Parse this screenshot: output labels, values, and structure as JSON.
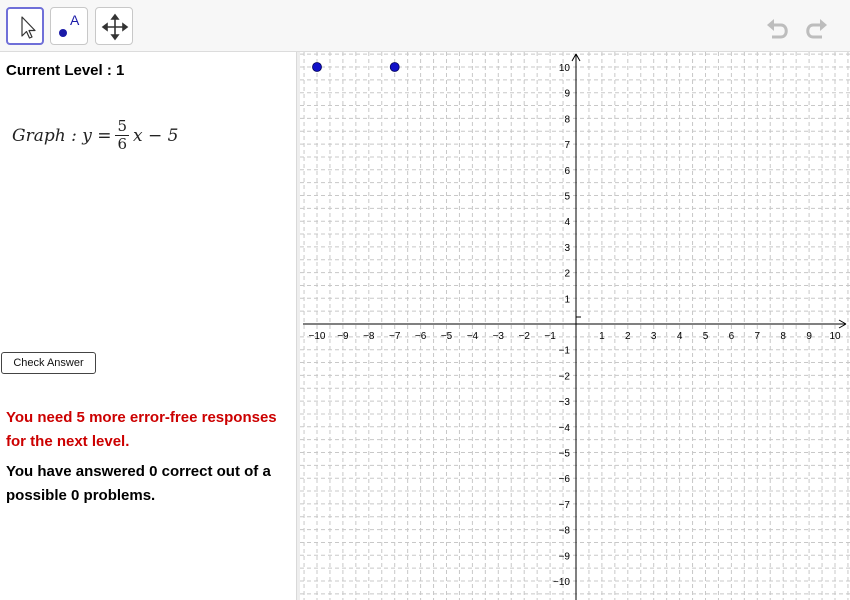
{
  "toolbar": {
    "tools": [
      {
        "name": "move-tool",
        "icon": "arrow-cursor-icon",
        "selected": true
      },
      {
        "name": "point-tool",
        "icon": "point-with-label-icon",
        "label": "A",
        "selected": false
      },
      {
        "name": "move-graphics-view-tool",
        "icon": "four-way-arrow-icon",
        "selected": false
      }
    ],
    "undo_icon": "undo-icon",
    "redo_icon": "redo-icon"
  },
  "panel": {
    "level_text": "Current Level : 1",
    "equation": {
      "prefix": "Graph : y =",
      "numerator": "5",
      "denominator": "6",
      "suffix": "x − 5"
    },
    "check_button_label": "Check Answer",
    "error_free_message": "You need 5 more error-free responses for the next level.",
    "score_message": "You have answered 0 correct out of a possible 0 problems."
  },
  "graph": {
    "x_range": [
      -10,
      10
    ],
    "y_range": [
      -10,
      10
    ],
    "x_ticks": [
      -10,
      -9,
      -8,
      -7,
      -6,
      -5,
      -4,
      -3,
      -2,
      -1,
      1,
      2,
      3,
      4,
      5,
      6,
      7,
      8,
      9,
      10
    ],
    "y_ticks": [
      -10,
      -9,
      -8,
      -7,
      -6,
      -5,
      -4,
      -3,
      -2,
      -1,
      1,
      2,
      3,
      4,
      5,
      6,
      7,
      8,
      9,
      10
    ],
    "grid": "dashed",
    "points": [
      {
        "x": -10,
        "y": 10
      },
      {
        "x": -7,
        "y": 10
      }
    ],
    "colors": {
      "point": "#1010c8",
      "grid": "#c8c8c8",
      "axis": "#000000"
    }
  }
}
